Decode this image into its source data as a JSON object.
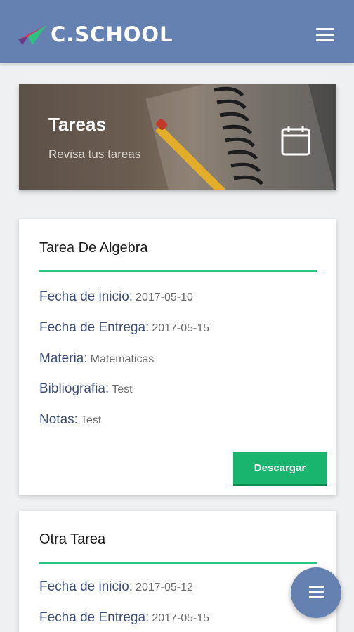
{
  "header": {
    "brand": "C.SCHOOL",
    "logo_icon": "paper-plane-logo-icon",
    "menu_icon": "hamburger-icon",
    "color": "#6481b2"
  },
  "hero": {
    "title": "Tareas",
    "subtitle": "Revisa tus tareas",
    "icon": "calendar-icon"
  },
  "tasks": [
    {
      "title": "Tarea De Algebra",
      "fields": [
        {
          "label": "Fecha de inicio:",
          "value": "2017-05-10"
        },
        {
          "label": "Fecha de Entrega:",
          "value": "2017-05-15"
        },
        {
          "label": "Materia:",
          "value": "Matematicas"
        },
        {
          "label": "Bibliografia:",
          "value": "Test"
        },
        {
          "label": "Notas:",
          "value": "Test"
        }
      ],
      "button": "Descargar"
    },
    {
      "title": "Otra Tarea",
      "fields": [
        {
          "label": "Fecha de inicio:",
          "value": "2017-05-12"
        },
        {
          "label": "Fecha de Entrega:",
          "value": "2017-05-15"
        }
      ]
    }
  ],
  "fab_icon": "menu-fab-icon",
  "colors": {
    "accent": "#2ec27e",
    "button": "#19b56e",
    "label": "#3e4f7a"
  }
}
